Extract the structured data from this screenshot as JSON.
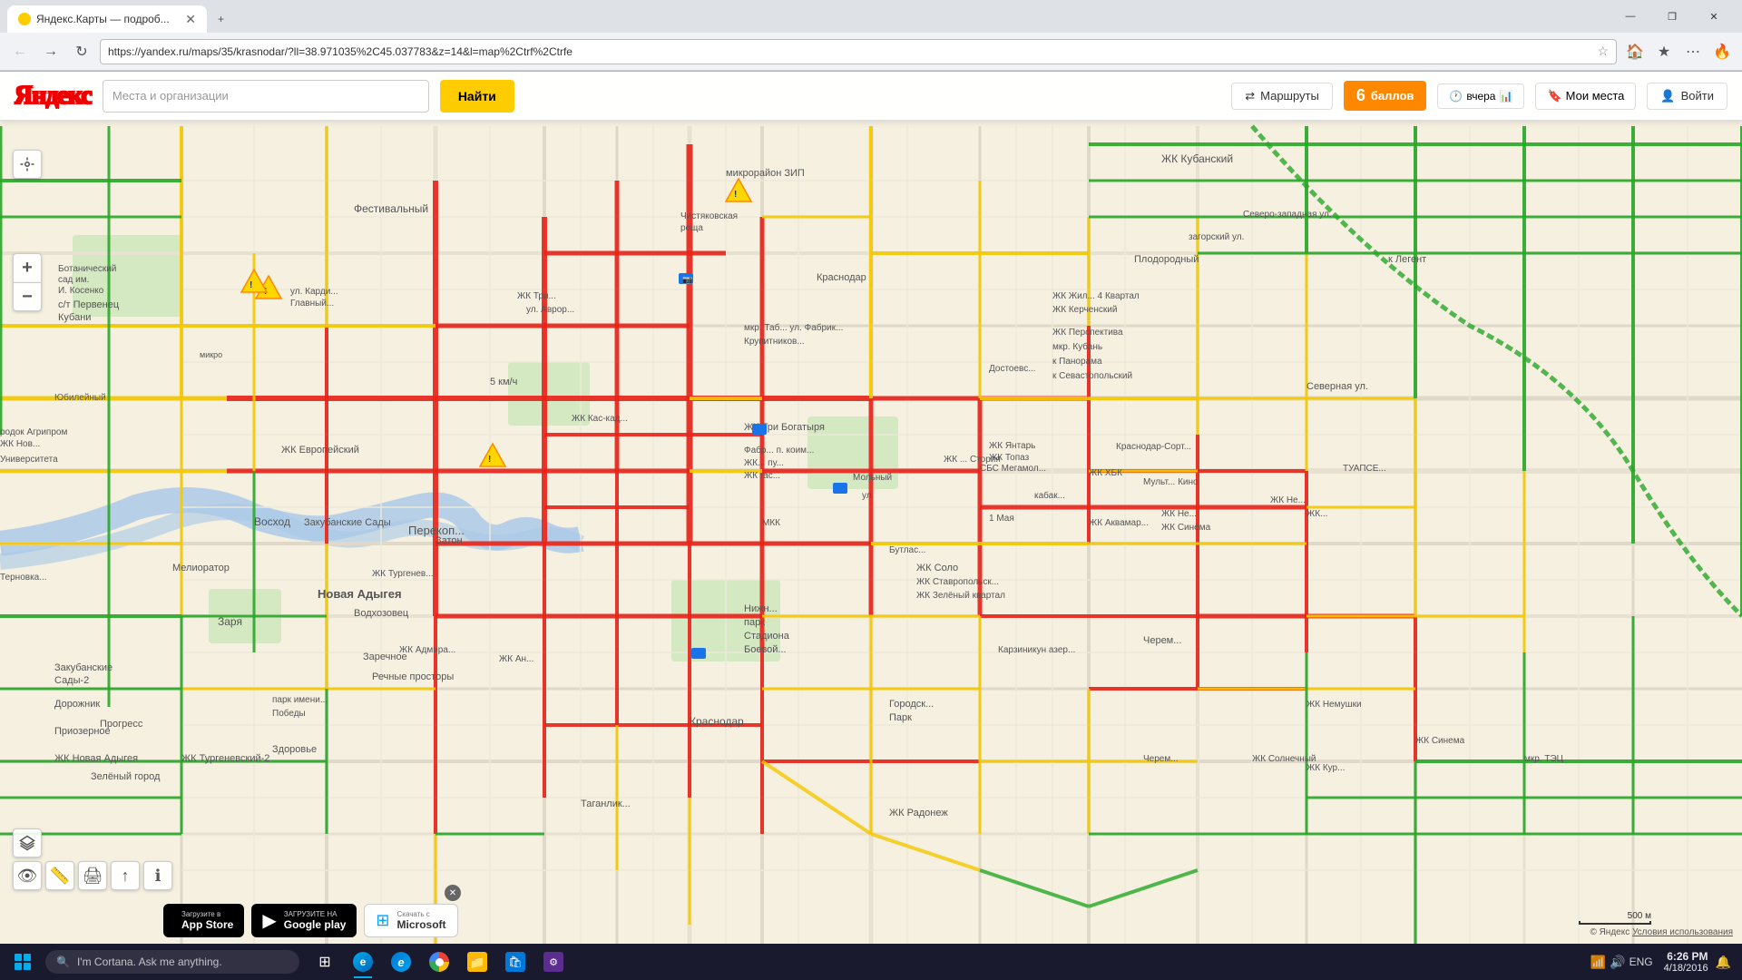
{
  "browser": {
    "tab_title": "Яндекс.Карты — подроб...",
    "tab_inactive": "",
    "url": "https://yandex.ru/maps/35/krasnodar/?ll=38.971035%2C45.037783&z=14&l=map%2Ctrf%2Ctrfe",
    "win_min": "—",
    "win_restore": "❐",
    "win_close": "✕"
  },
  "yandex": {
    "logo": "Яндекс",
    "search_placeholder": "Места и организации",
    "search_hint": "Яндекс",
    "find_btn": "Найти",
    "routes_btn": "Маршруты",
    "score_label": "баллов",
    "score_num": "6",
    "traffic_time": "вчера",
    "bookmark_btn": "Мои места",
    "signin_btn": "Войти"
  },
  "map": {
    "speed_label": "5 км/ч",
    "attribution": "© Яндекс",
    "terms": "Условия использования",
    "scale_label": "500 м"
  },
  "app_stores": {
    "apple_pre": "Загрузите в",
    "apple_main": "App Store",
    "google_pre": "ЗАГРУЗИТЕ НА",
    "google_main": "Google play",
    "microsoft_pre": "Скачать с",
    "microsoft_main": "Microsoft"
  },
  "taskbar": {
    "search_placeholder": "I'm Cortana. Ask me anything.",
    "time": "6:26 PM",
    "date": "4/18/2016",
    "lang": "ENG"
  }
}
